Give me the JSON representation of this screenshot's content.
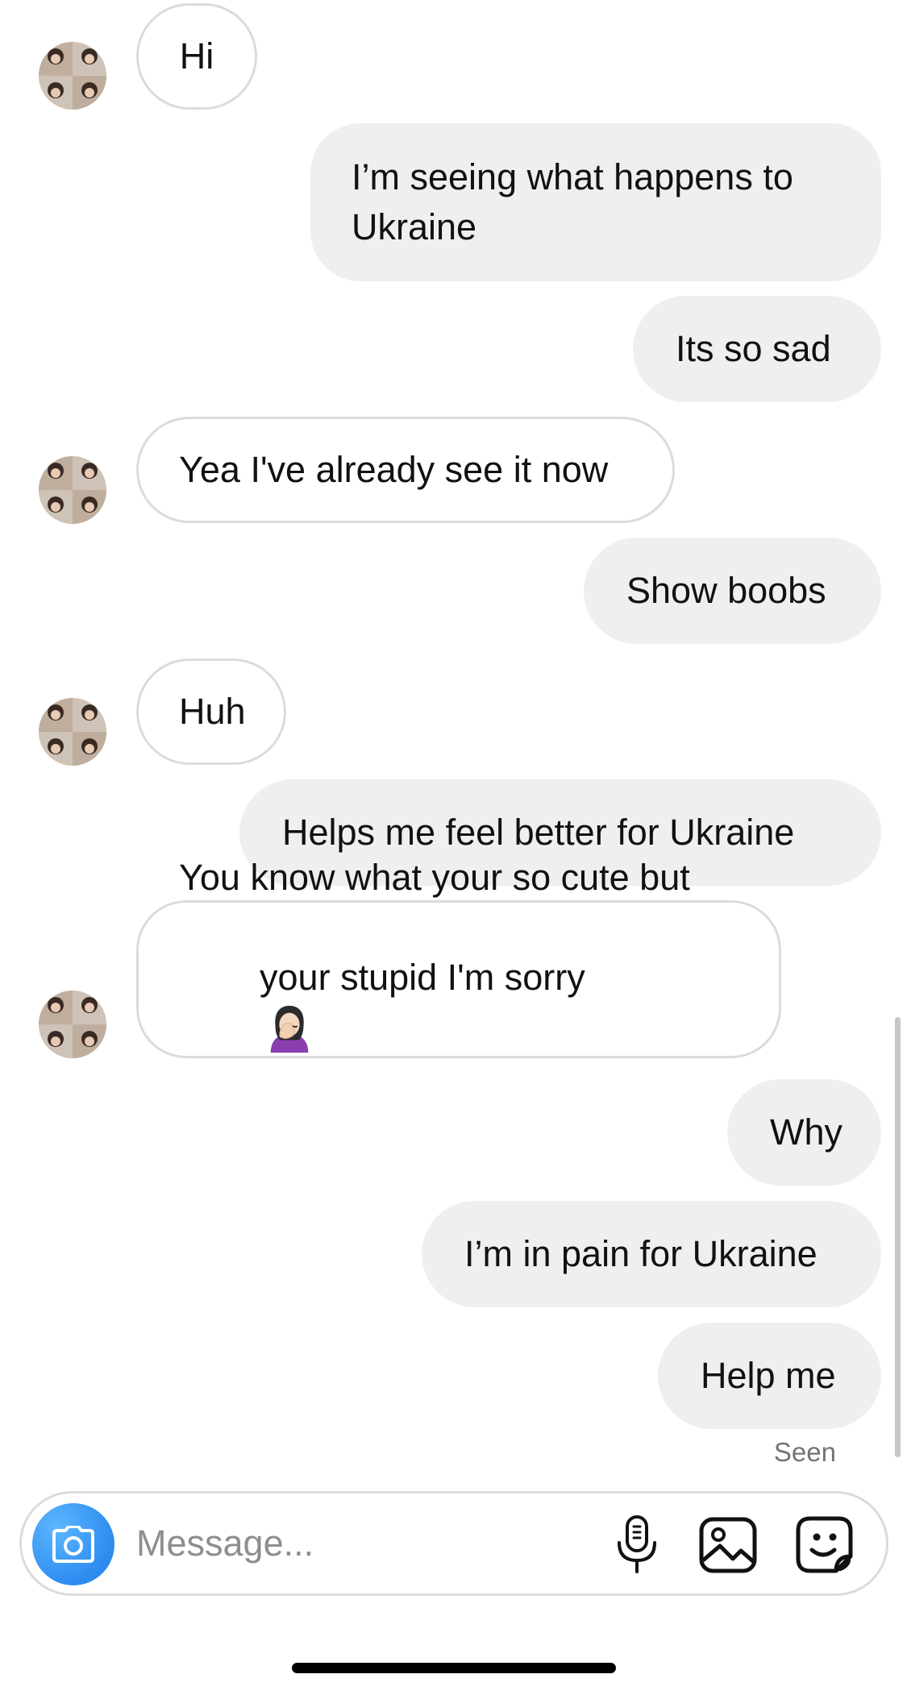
{
  "thread": {
    "messages": [
      {
        "sender": "them",
        "text": "Hi"
      },
      {
        "sender": "me",
        "text": "I’m seeing what happens to\nUkraine"
      },
      {
        "sender": "me",
        "text": "Its so sad"
      },
      {
        "sender": "them",
        "text": "Yea I've already see it now"
      },
      {
        "sender": "me",
        "text": "Show boobs"
      },
      {
        "sender": "them",
        "text": "Huh"
      },
      {
        "sender": "me",
        "text": "Helps me feel better for Ukraine"
      },
      {
        "sender": "them",
        "text_line1": "You know what your so cute but",
        "text_line2": "your stupid I'm sorry",
        "emoji": "woman-facepalming-emoji"
      },
      {
        "sender": "me",
        "text": "Why"
      },
      {
        "sender": "me",
        "text": "I’m in pain for Ukraine"
      },
      {
        "sender": "me",
        "text": "Help me"
      }
    ],
    "seen_label": "Seen"
  },
  "composer": {
    "placeholder": "Message...",
    "value": "",
    "icons": [
      "camera-icon",
      "microphone-icon",
      "image-icon",
      "sticker-icon"
    ]
  },
  "colors": {
    "incoming_border": "#dbdbdb",
    "outgoing_bg": "#efefef",
    "camera_button": "#3797f0",
    "meta_text": "#737373"
  }
}
